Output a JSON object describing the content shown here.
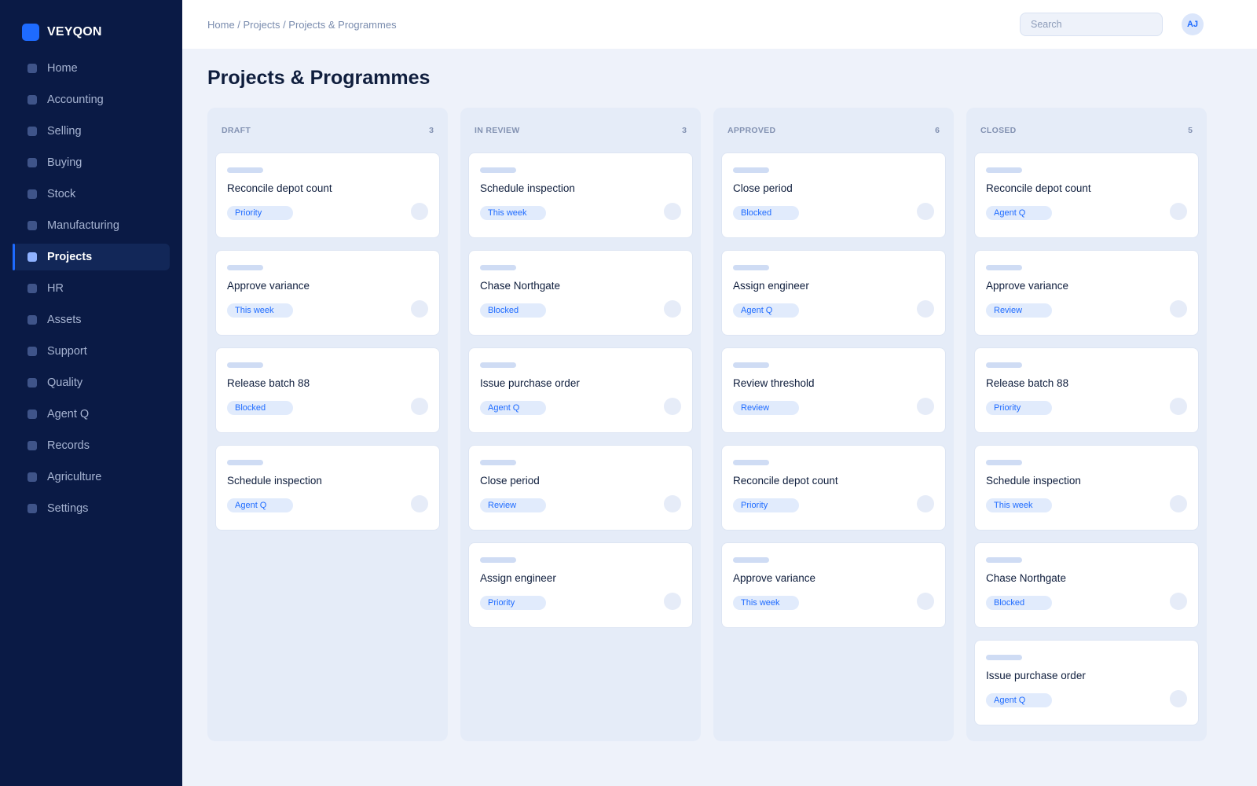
{
  "brand": {
    "name": "VEYQON"
  },
  "sidebar": {
    "items": [
      {
        "label": "Home",
        "active": false
      },
      {
        "label": "Accounting",
        "active": false
      },
      {
        "label": "Selling",
        "active": false
      },
      {
        "label": "Buying",
        "active": false
      },
      {
        "label": "Stock",
        "active": false
      },
      {
        "label": "Manufacturing",
        "active": false
      },
      {
        "label": "Projects",
        "active": true
      },
      {
        "label": "HR",
        "active": false
      },
      {
        "label": "Assets",
        "active": false
      },
      {
        "label": "Support",
        "active": false
      },
      {
        "label": "Quality",
        "active": false
      },
      {
        "label": "Agent Q",
        "active": false
      },
      {
        "label": "Records",
        "active": false
      },
      {
        "label": "Agriculture",
        "active": false
      },
      {
        "label": "Settings",
        "active": false
      }
    ]
  },
  "header": {
    "breadcrumb": "Home / Projects / Projects & Programmes",
    "search_placeholder": "Search",
    "avatar_initials": "AJ"
  },
  "page": {
    "title": "Projects & Programmes"
  },
  "board": {
    "columns": [
      {
        "title": "DRAFT",
        "count": "3",
        "cards": [
          {
            "title": "Reconcile depot count",
            "tag": "Priority"
          },
          {
            "title": "Approve variance",
            "tag": "This week"
          },
          {
            "title": "Release batch 88",
            "tag": "Blocked"
          },
          {
            "title": "Schedule inspection",
            "tag": "Agent Q"
          }
        ]
      },
      {
        "title": "IN REVIEW",
        "count": "3",
        "cards": [
          {
            "title": "Schedule inspection",
            "tag": "This week"
          },
          {
            "title": "Chase Northgate",
            "tag": "Blocked"
          },
          {
            "title": "Issue purchase order",
            "tag": "Agent Q"
          },
          {
            "title": "Close period",
            "tag": "Review"
          },
          {
            "title": "Assign engineer",
            "tag": "Priority"
          }
        ]
      },
      {
        "title": "APPROVED",
        "count": "6",
        "cards": [
          {
            "title": "Close period",
            "tag": "Blocked"
          },
          {
            "title": "Assign engineer",
            "tag": "Agent Q"
          },
          {
            "title": "Review threshold",
            "tag": "Review"
          },
          {
            "title": "Reconcile depot count",
            "tag": "Priority"
          },
          {
            "title": "Approve variance",
            "tag": "This week"
          }
        ]
      },
      {
        "title": "CLOSED",
        "count": "5",
        "cards": [
          {
            "title": "Reconcile depot count",
            "tag": "Agent Q"
          },
          {
            "title": "Approve variance",
            "tag": "Review"
          },
          {
            "title": "Release batch 88",
            "tag": "Priority"
          },
          {
            "title": "Schedule inspection",
            "tag": "This week"
          },
          {
            "title": "Chase Northgate",
            "tag": "Blocked"
          },
          {
            "title": "Issue purchase order",
            "tag": "Agent Q"
          }
        ]
      }
    ]
  },
  "colors": {
    "sidebar_bg": "#0a1a45",
    "accent": "#1e6bff",
    "page_bg": "#eef2fa",
    "column_bg": "#e5ecf8",
    "tag_bg": "#e1ebfc"
  }
}
